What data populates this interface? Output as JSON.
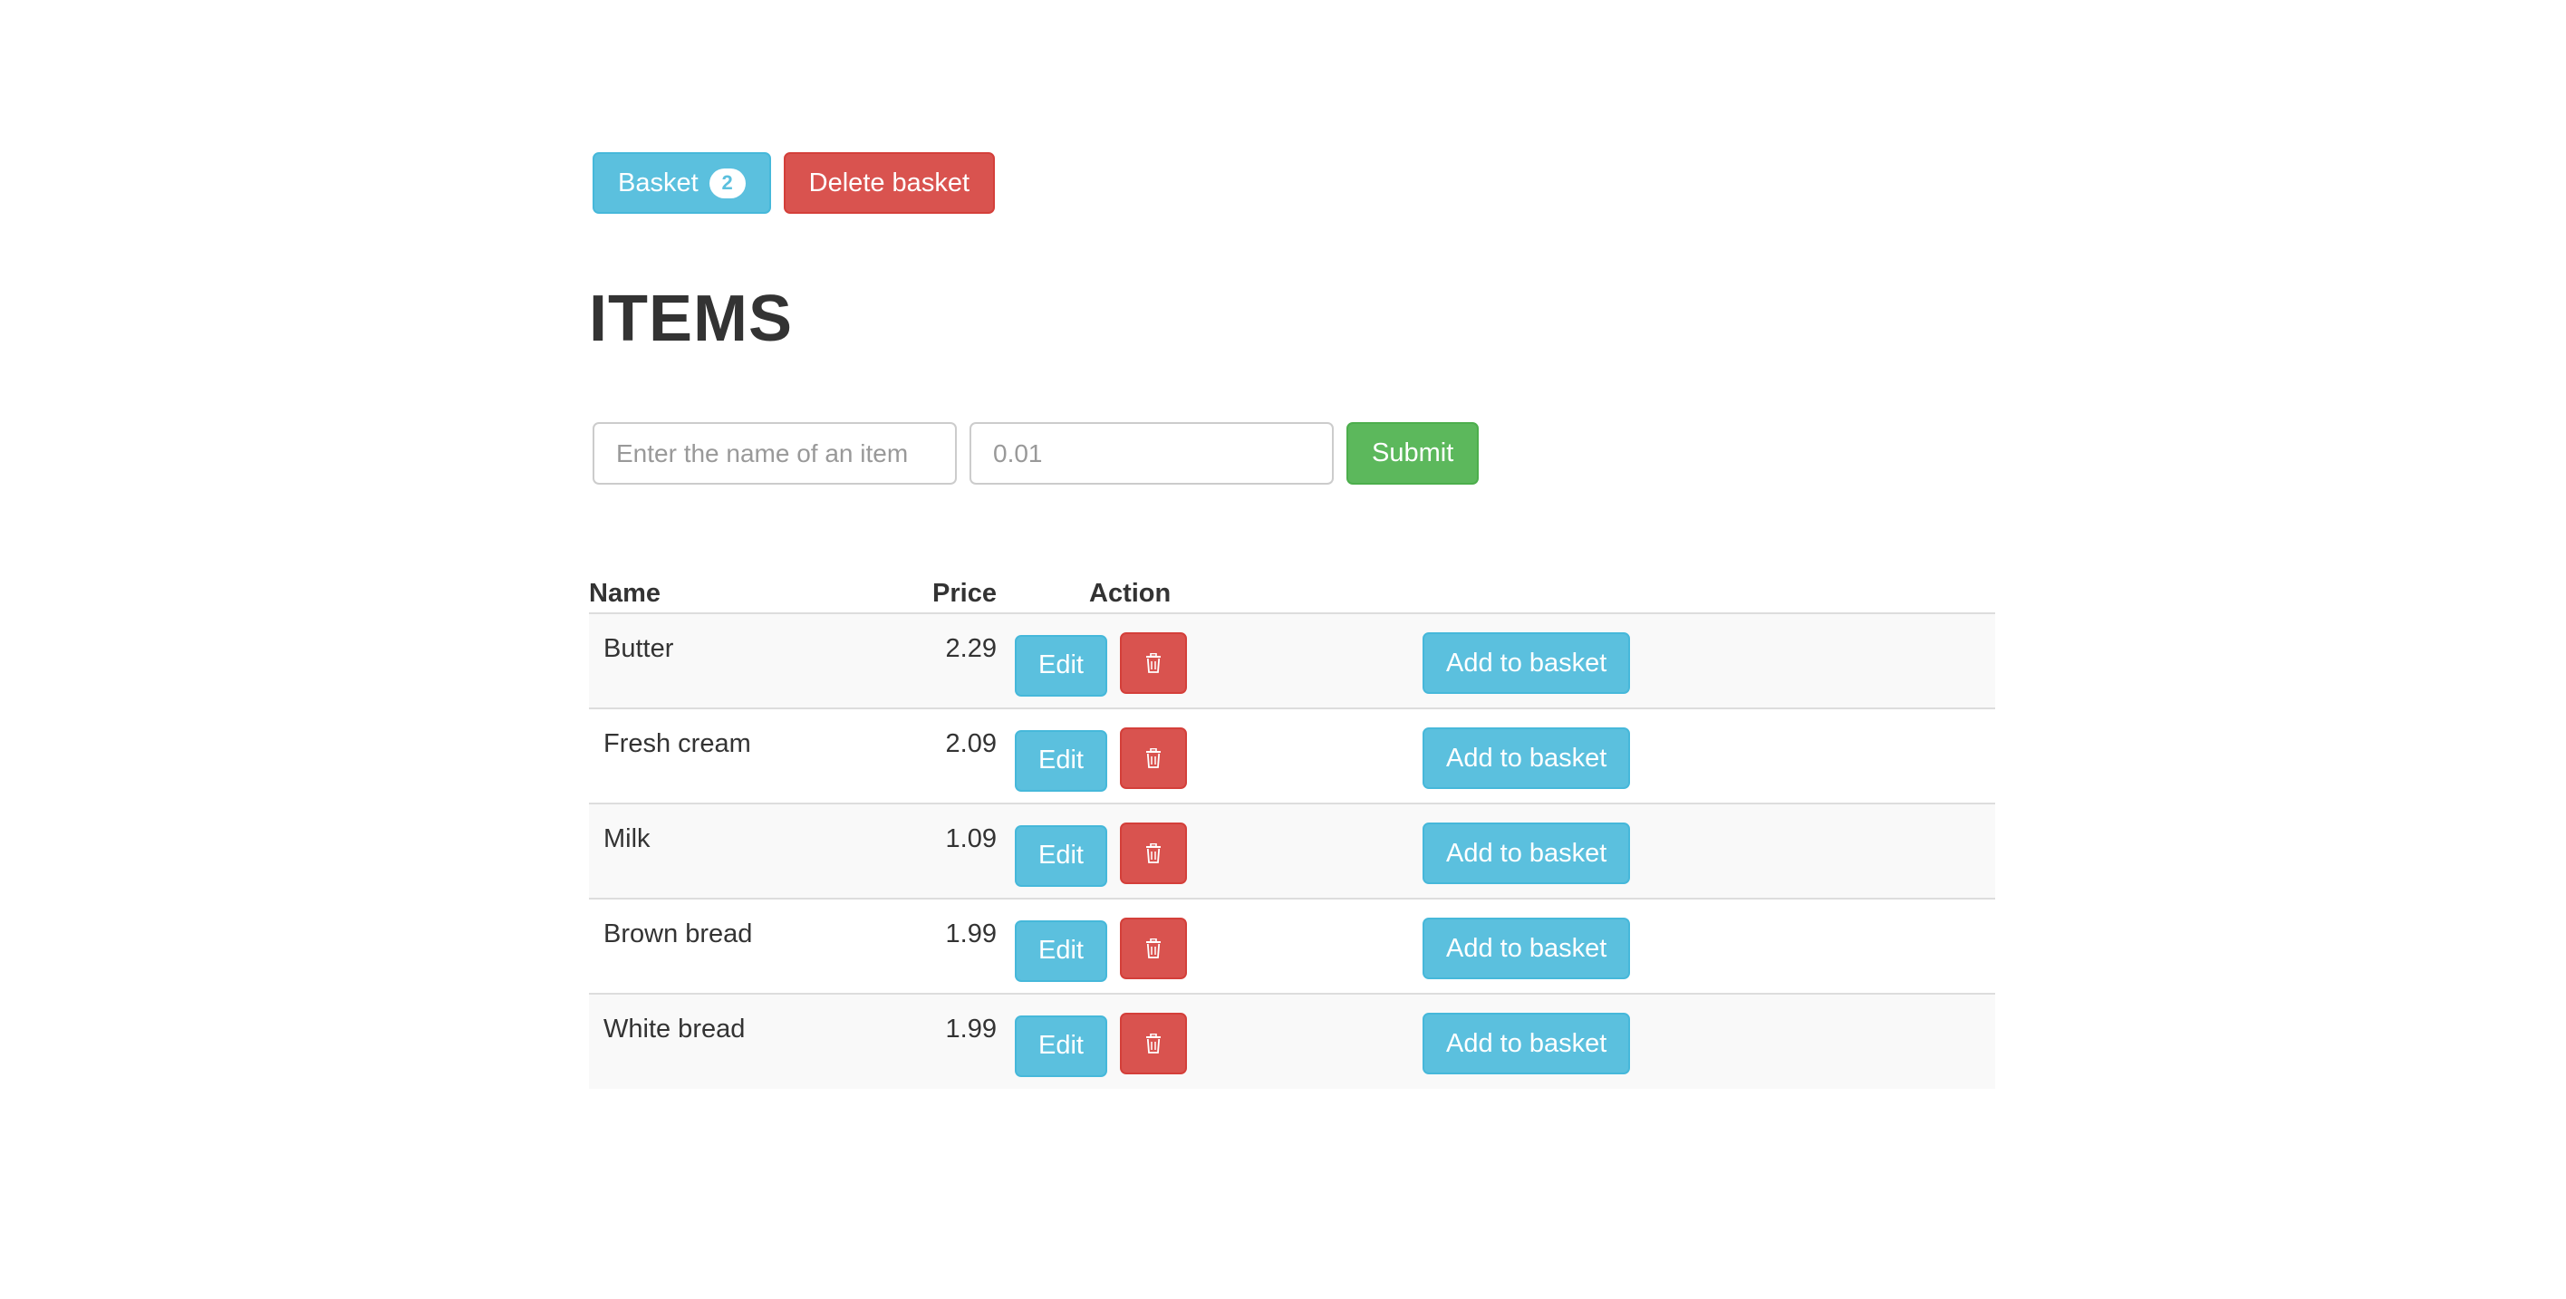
{
  "toolbar": {
    "basket_label": "Basket",
    "basket_count": "2",
    "delete_basket_label": "Delete basket"
  },
  "page": {
    "title": "ITEMS"
  },
  "form": {
    "name_placeholder": "Enter the name of an item",
    "price_placeholder": "0.01",
    "submit_label": "Submit"
  },
  "table": {
    "headers": {
      "name": "Name",
      "price": "Price",
      "action": "Action"
    },
    "rows": [
      {
        "name": "Butter",
        "price": "2.29",
        "edit_label": "Edit",
        "basket_label": "Add to basket"
      },
      {
        "name": "Fresh cream",
        "price": "2.09",
        "edit_label": "Edit",
        "basket_label": "Add to basket"
      },
      {
        "name": "Milk",
        "price": "1.09",
        "edit_label": "Edit",
        "basket_label": "Add to basket"
      },
      {
        "name": "Brown bread",
        "price": "1.99",
        "edit_label": "Edit",
        "basket_label": "Add to basket"
      },
      {
        "name": "White bread",
        "price": "1.99",
        "edit_label": "Edit",
        "basket_label": "Add to basket"
      }
    ]
  },
  "icons": {
    "delete": "trash-icon"
  },
  "colors": {
    "info": "#5bc0de",
    "danger": "#d9534f",
    "success": "#5cb85c"
  }
}
